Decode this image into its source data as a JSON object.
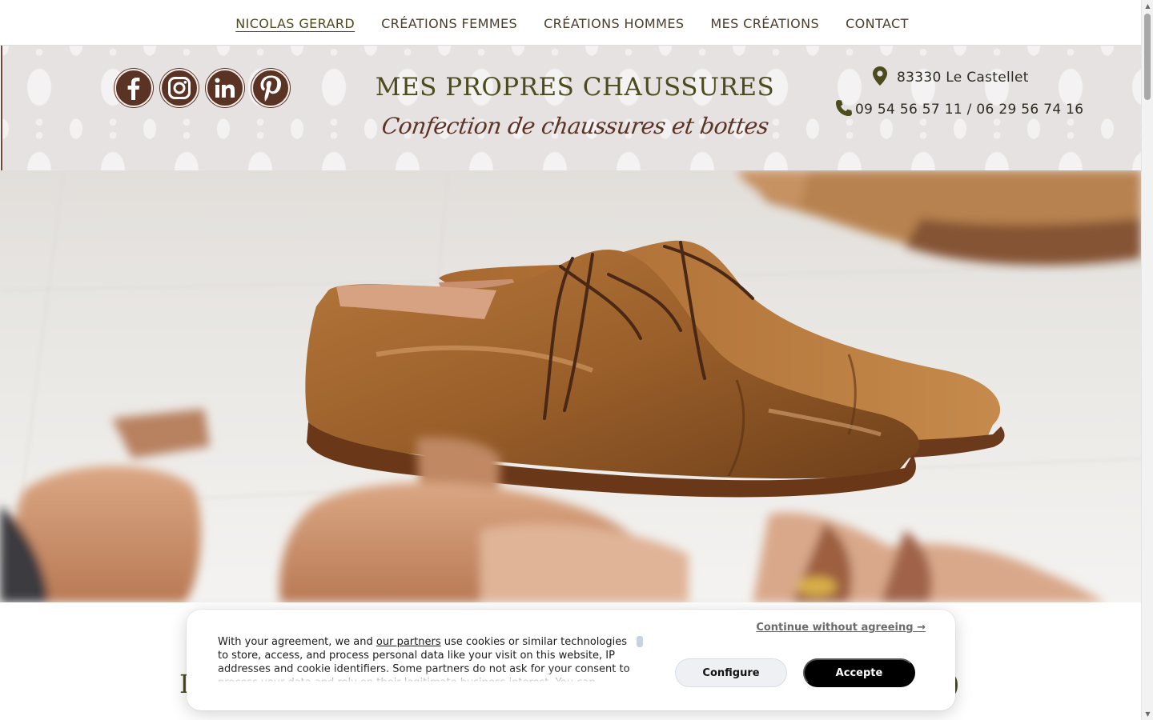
{
  "nav": {
    "items": [
      {
        "label": "NICOLAS GERARD",
        "active": true
      },
      {
        "label": "CRÉATIONS FEMMES",
        "active": false
      },
      {
        "label": "CRÉATIONS HOMMES",
        "active": false
      },
      {
        "label": "MES CRÉATIONS",
        "active": false
      },
      {
        "label": "CONTACT",
        "active": false
      }
    ]
  },
  "header": {
    "socials": [
      {
        "icon": "facebook-icon"
      },
      {
        "icon": "instagram-icon"
      },
      {
        "icon": "linkedin-icon"
      },
      {
        "icon": "pinterest-icon"
      }
    ],
    "title": "MES PROPRES CHAUSSURES",
    "subtitle": "Confection de chaussures et bottes",
    "address": "83330 Le Castellet",
    "phone": "09 54 56 57 11 / 06 29 56 74 16",
    "address_icon": "map-pin-icon",
    "phone_icon": "phone-icon"
  },
  "hero": {
    "image": "brown leather oxford shoes with wooden shoe trees"
  },
  "cookie": {
    "text_before_link": "With your agreement, we and ",
    "link": "our partners",
    "text_after_link": " use cookies or similar technologies to store, access, and process personal data like your visit on this website, IP addresses and cookie identifiers. Some partners do not ask for your consent to process your data and rely on their legitimate business interest. You can",
    "continue": "Continue without agreeing →",
    "configure": "Configure",
    "accept": "Accepte"
  },
  "colors": {
    "brand_green": "#4b4b1c",
    "brand_brown": "#5a3324",
    "accept_bg": "#000000",
    "configure_bg": "#eef0f4"
  }
}
